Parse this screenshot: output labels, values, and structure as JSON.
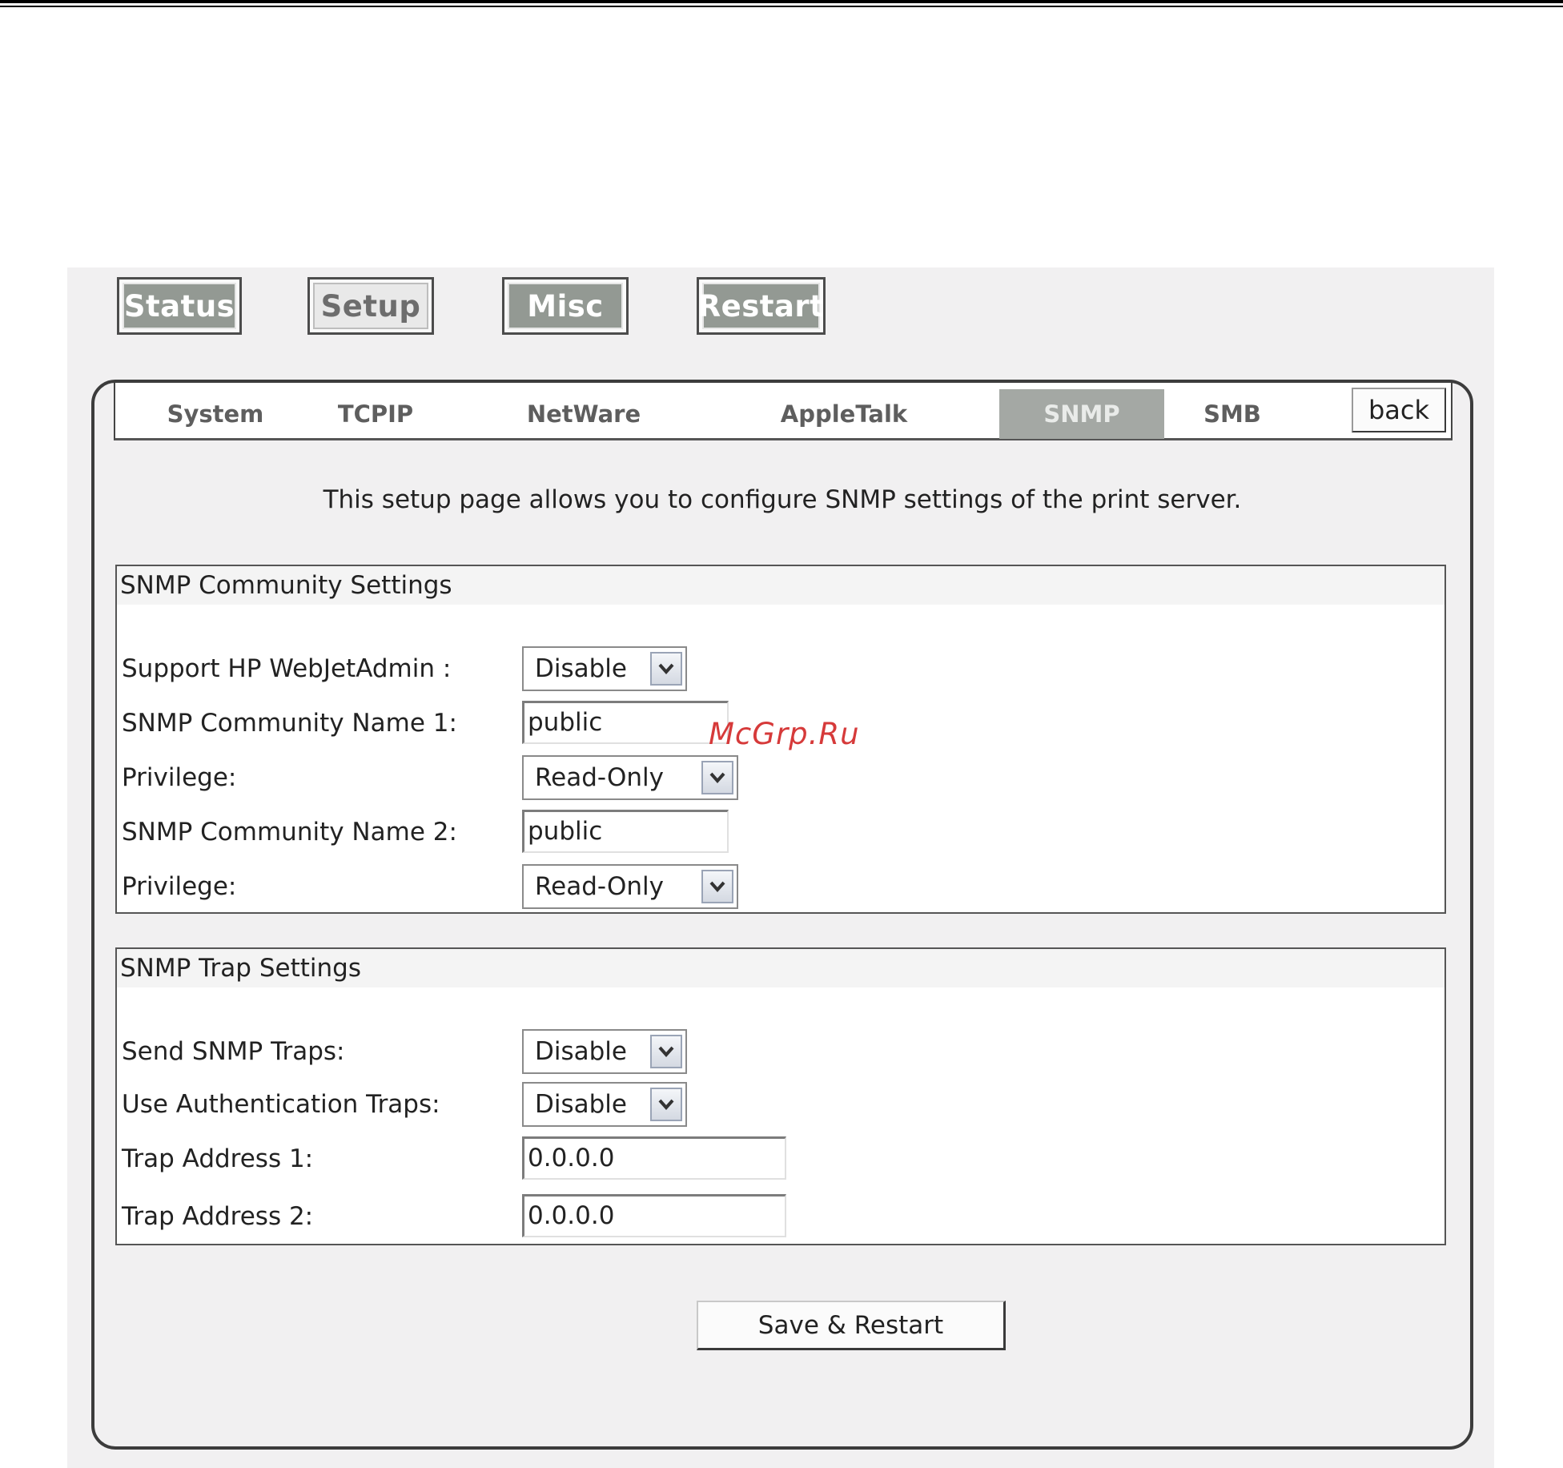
{
  "topnav": [
    {
      "label": "Status",
      "active": false
    },
    {
      "label": "Setup",
      "active": true
    },
    {
      "label": "Misc",
      "active": false
    },
    {
      "label": "Restart",
      "active": false
    }
  ],
  "tabs": [
    {
      "label": "System"
    },
    {
      "label": "TCPIP"
    },
    {
      "label": "NetWare"
    },
    {
      "label": "AppleTalk"
    },
    {
      "label": "SNMP",
      "active": true
    },
    {
      "label": "SMB"
    }
  ],
  "back_label": "back",
  "intro": "This setup page allows you to configure SNMP settings of the print server.",
  "community": {
    "title": "SNMP Community Settings",
    "webjet_label": "Support HP WebJetAdmin :",
    "webjet_value": "Disable",
    "name1_label": "SNMP Community Name 1:",
    "name1_value": "public",
    "priv1_label": "Privilege:",
    "priv1_value": "Read-Only",
    "name2_label": "SNMP Community Name 2:",
    "name2_value": "public",
    "priv2_label": "Privilege:",
    "priv2_value": "Read-Only"
  },
  "trap": {
    "title": "SNMP Trap Settings",
    "send_label": "Send SNMP Traps:",
    "send_value": "Disable",
    "auth_label": "Use Authentication Traps:",
    "auth_value": "Disable",
    "addr1_label": "Trap Address 1:",
    "addr1_value": "0.0.0.0",
    "addr2_label": "Trap Address 2:",
    "addr2_value": "0.0.0.0"
  },
  "save_label": "Save & Restart",
  "watermark": "McGrp.Ru",
  "colors": {
    "nav_button": "#939993",
    "active_tab": "#a4a8a4",
    "canvas": "#f1f0f1",
    "watermark": "#d63a3a"
  }
}
